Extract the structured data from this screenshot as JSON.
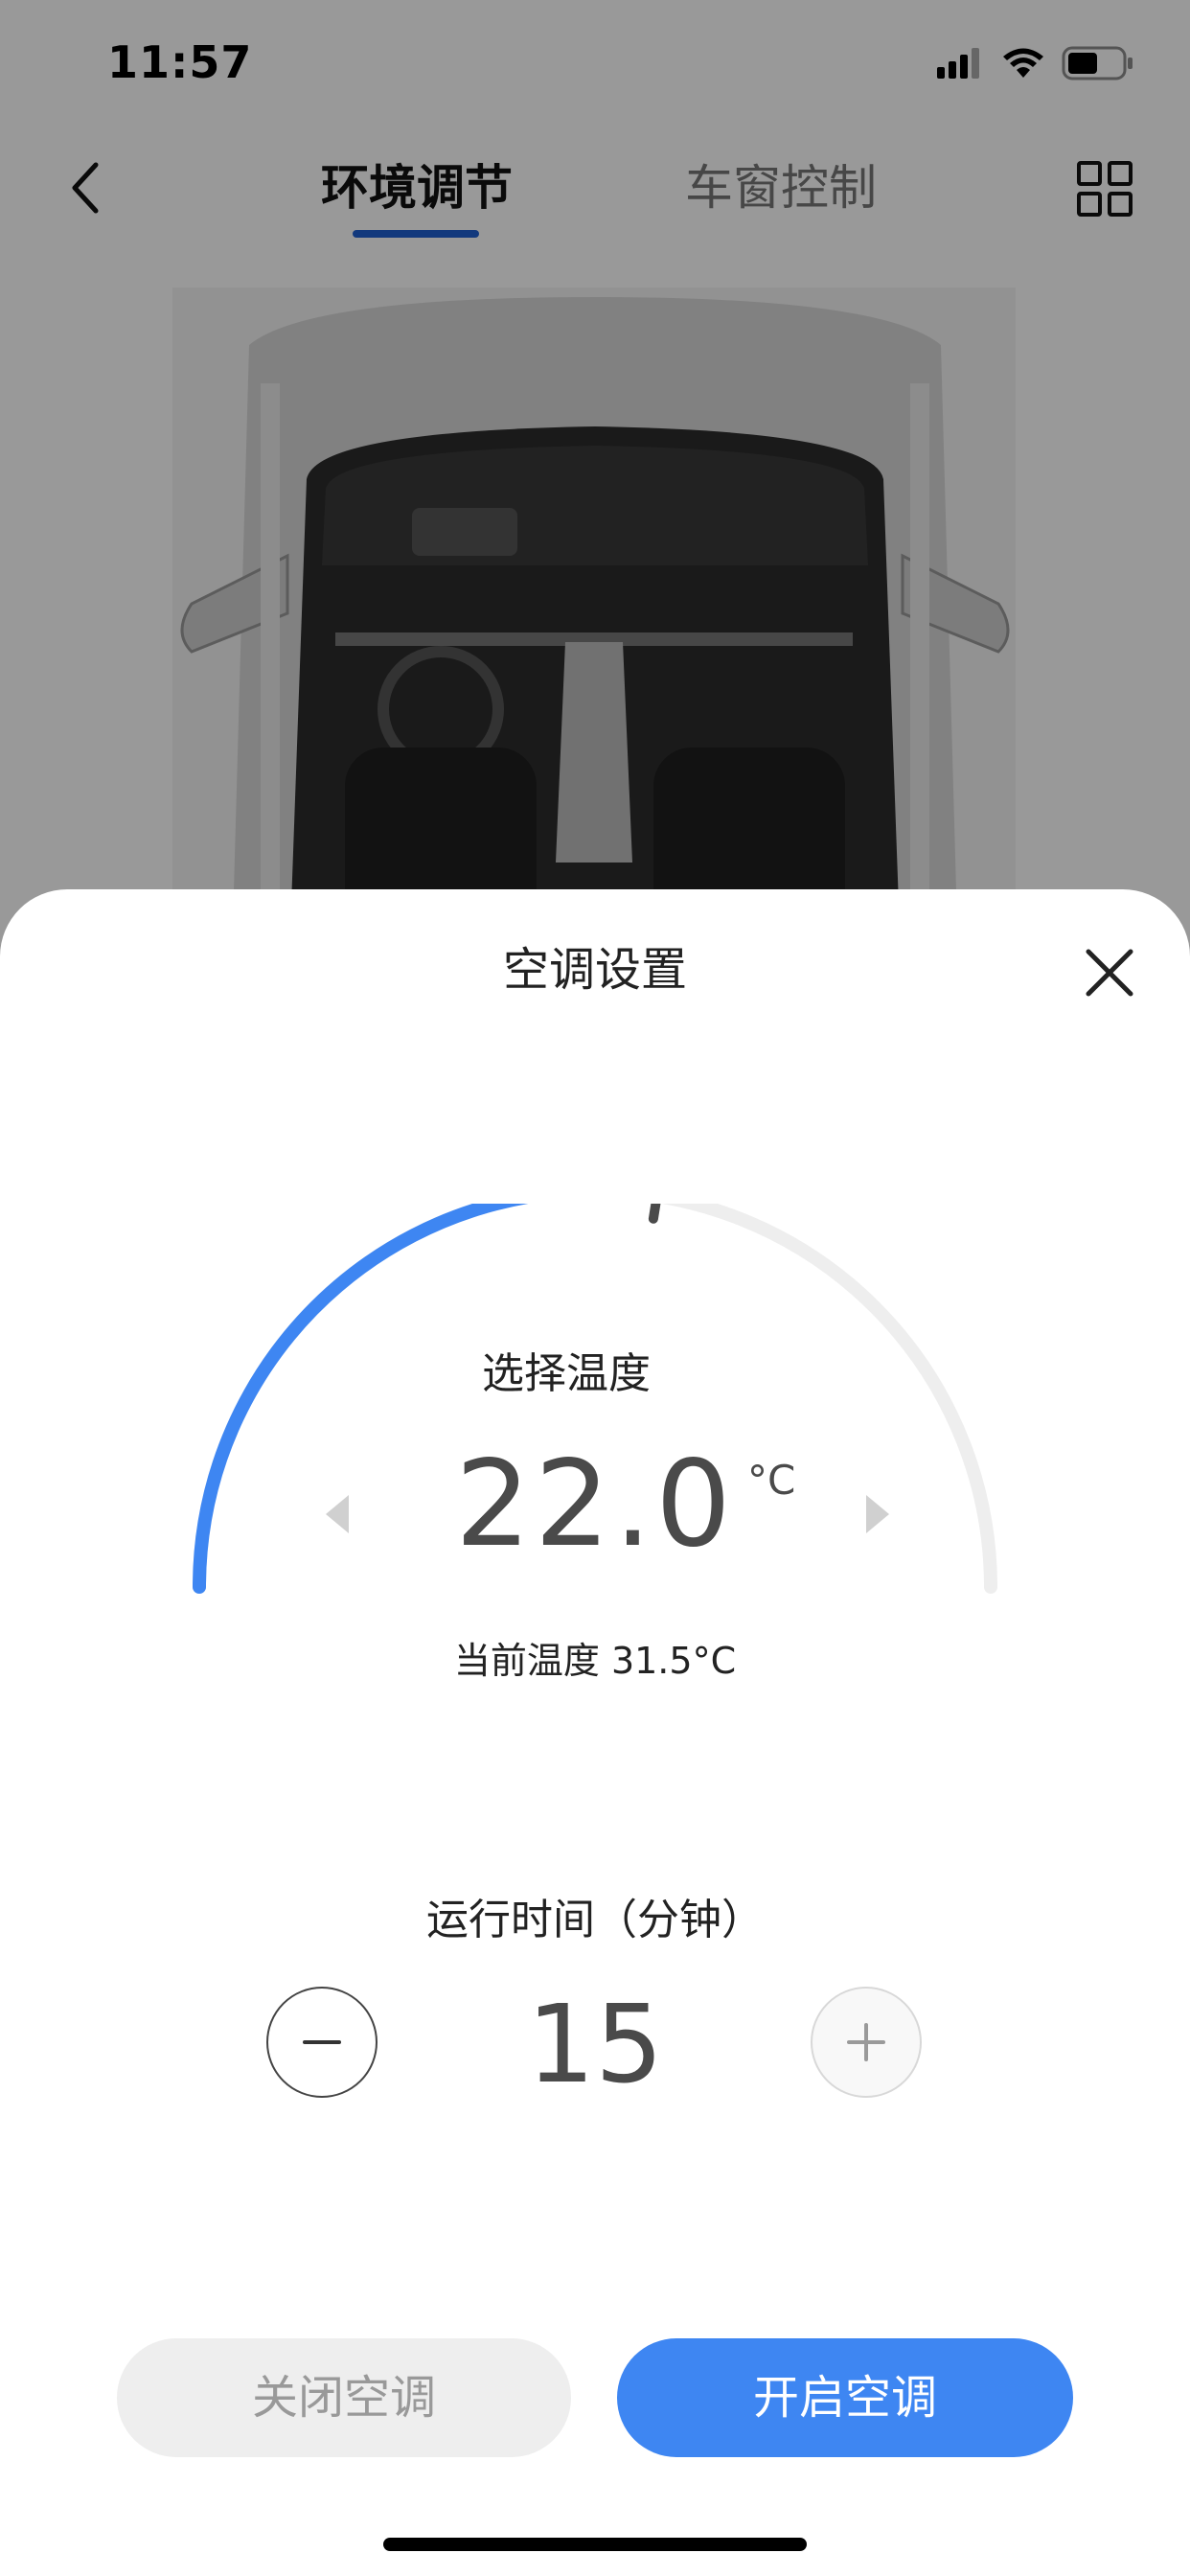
{
  "status_bar": {
    "time": "11:57"
  },
  "nav": {
    "tabs": [
      {
        "label": "环境调节",
        "active": true
      },
      {
        "label": "车窗控制",
        "active": false
      }
    ],
    "back_icon": "chevron-left-icon",
    "menu_icon": "grid-icon",
    "accent_color": "#1f5fd1"
  },
  "sheet": {
    "title": "空调设置",
    "temperature": {
      "label": "选择温度",
      "value": "22.0",
      "unit": "°C",
      "current": "当前温度 31.5°C",
      "dial_fill_fraction": 0.55,
      "dial_color": "#3e86f2",
      "track_color": "#eeeeee"
    },
    "runtime": {
      "label": "运行时间（分钟）",
      "value": "15"
    },
    "buttons": {
      "off": "关闭空调",
      "on": "开启空调"
    }
  }
}
